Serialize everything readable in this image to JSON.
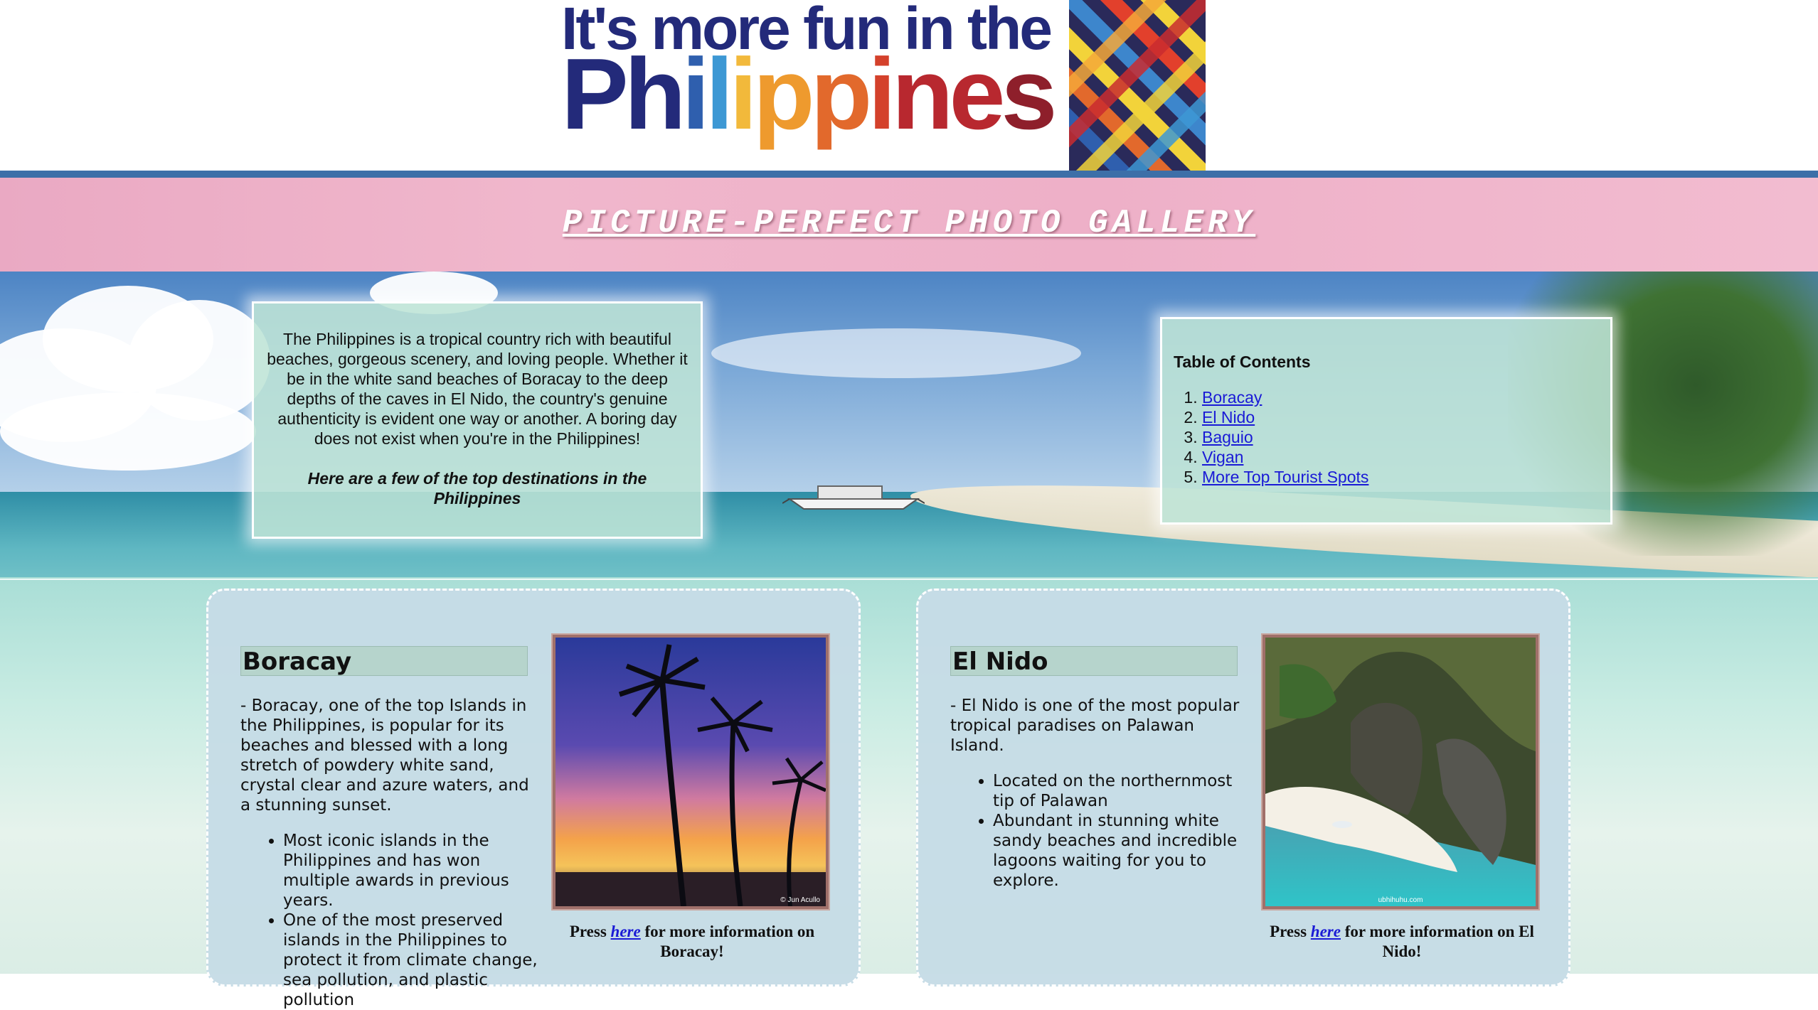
{
  "header": {
    "logo_line1": "It's more fun in the",
    "logo_line2": "Philippines"
  },
  "banner": {
    "title": "PICTURE-PERFECT PHOTO GALLERY"
  },
  "intro": {
    "paragraph": "The Philippines is a tropical country rich with beautiful beaches, gorgeous scenery, and loving people. Whether it be in the white sand beaches of Boracay to the deep depths of the caves in El Nido, the country's genuine authenticity is evident one way or another. A boring day does not exist when you're in the Philippines!",
    "tagline": "Here are a few of the top destinations in the Philippines"
  },
  "toc": {
    "title": "Table of Contents",
    "items": [
      {
        "label": "Boracay"
      },
      {
        "label": "El Nido"
      },
      {
        "label": "Baguio"
      },
      {
        "label": "Vigan"
      },
      {
        "label": "More Top Tourist Spots"
      }
    ]
  },
  "cards": {
    "boracay": {
      "heading": "Boracay",
      "description": "- Boracay, one of the top Islands in the Philippines, is popular for its beaches and blessed with a long stretch of powdery white sand, crystal clear and azure waters, and a stunning sunset.",
      "bullets": [
        "Most iconic islands in the Philippines and has won multiple awards in previous years.",
        "One of the most preserved islands in the Philippines to protect it from climate change, sea pollution, and plastic pollution"
      ],
      "caption_prefix": "Press",
      "caption_link": "here",
      "caption_suffix": "for more information on Boracay!",
      "photo_credit": "© Jun Acullo"
    },
    "elnido": {
      "heading": "El Nido",
      "description": "- El Nido is one of the most popular tropical paradises on Palawan Island.",
      "bullets": [
        "Located on the northernmost tip of Palawan",
        "Abundant in stunning white sandy beaches and incredible lagoons waiting for you to explore."
      ],
      "caption_prefix": "Press",
      "caption_link": "here",
      "caption_suffix": "for more information on El Nido!",
      "photo_credit": "ubhihuhu.com"
    }
  }
}
